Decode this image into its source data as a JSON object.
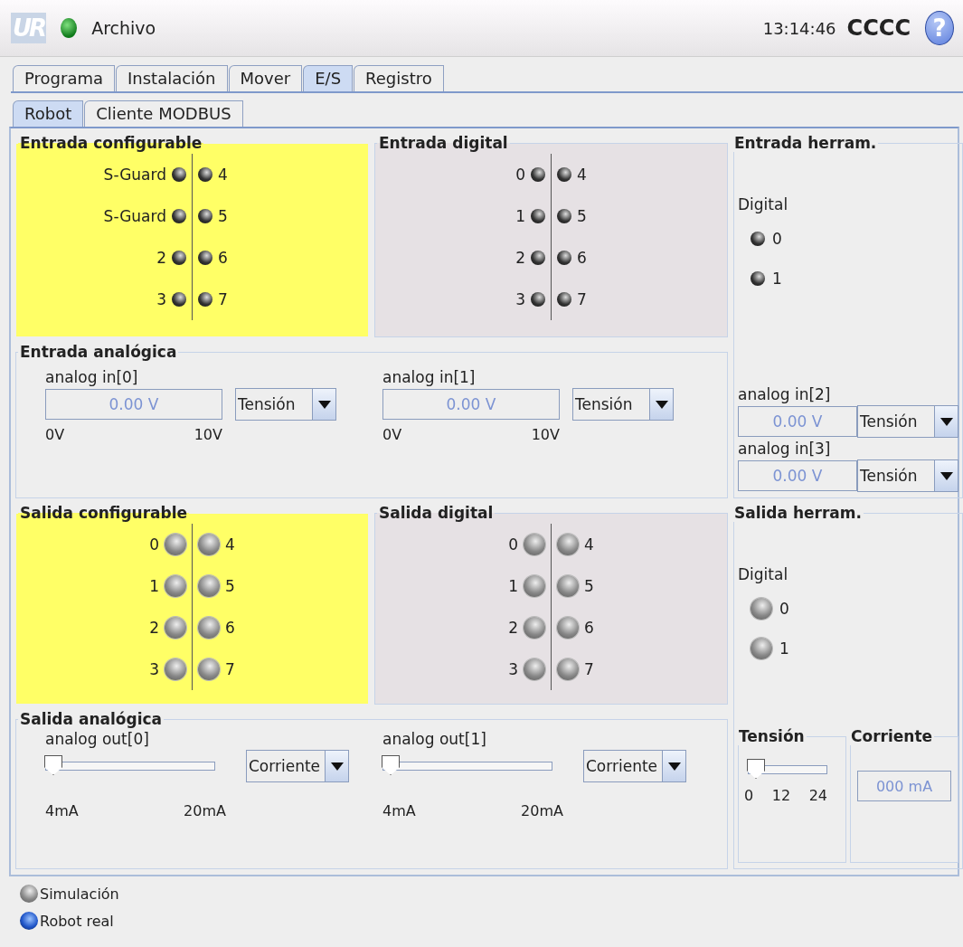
{
  "header": {
    "logo": "UR",
    "status_on": true,
    "menu": "Archivo",
    "time": "13:14:46",
    "robot_name": "CCCC",
    "help": "?"
  },
  "tabs": [
    {
      "label": "Programa",
      "selected": false
    },
    {
      "label": "Instalación",
      "selected": false
    },
    {
      "label": "Mover",
      "selected": false
    },
    {
      "label": "E/S",
      "selected": true
    },
    {
      "label": "Registro",
      "selected": false
    }
  ],
  "subtabs": [
    {
      "label": "Robot",
      "selected": true
    },
    {
      "label": "Cliente MODBUS",
      "selected": false
    }
  ],
  "entrada_configurable": {
    "title": "Entrada configurable",
    "kind": "input",
    "color": "#ffff66",
    "left": [
      {
        "label": "S-Guard",
        "on": false
      },
      {
        "label": "S-Guard",
        "on": false
      },
      {
        "label": "2",
        "on": false
      },
      {
        "label": "3",
        "on": false
      }
    ],
    "right": [
      {
        "label": "4",
        "on": false
      },
      {
        "label": "5",
        "on": false
      },
      {
        "label": "6",
        "on": false
      },
      {
        "label": "7",
        "on": false
      }
    ]
  },
  "entrada_digital": {
    "title": "Entrada digital",
    "kind": "input",
    "color": "#e6e1e4",
    "left": [
      {
        "label": "0",
        "on": false
      },
      {
        "label": "1",
        "on": false
      },
      {
        "label": "2",
        "on": false
      },
      {
        "label": "3",
        "on": false
      }
    ],
    "right": [
      {
        "label": "4",
        "on": false
      },
      {
        "label": "5",
        "on": false
      },
      {
        "label": "6",
        "on": false
      },
      {
        "label": "7",
        "on": false
      }
    ]
  },
  "entrada_herram": {
    "title": "Entrada herram.",
    "digital_label": "Digital",
    "leds": [
      {
        "label": "0",
        "on": false
      },
      {
        "label": "1",
        "on": false
      }
    ],
    "analog": [
      {
        "label": "analog in[2]",
        "value": "0.00 V",
        "mode": "Tensión"
      },
      {
        "label": "analog in[3]",
        "value": "0.00 V",
        "mode": "Tensión"
      }
    ]
  },
  "entrada_analogica": {
    "title": "Entrada analógica",
    "inputs": [
      {
        "label": "analog in[0]",
        "value": "0.00 V",
        "mode": "Tensión",
        "min": "0V",
        "max": "10V"
      },
      {
        "label": "analog in[1]",
        "value": "0.00 V",
        "mode": "Tensión",
        "min": "0V",
        "max": "10V"
      }
    ]
  },
  "salida_configurable": {
    "title": "Salida configurable",
    "kind": "output",
    "color": "#ffff66",
    "left": [
      {
        "label": "0",
        "on": false
      },
      {
        "label": "1",
        "on": false
      },
      {
        "label": "2",
        "on": false
      },
      {
        "label": "3",
        "on": false
      }
    ],
    "right": [
      {
        "label": "4",
        "on": false
      },
      {
        "label": "5",
        "on": false
      },
      {
        "label": "6",
        "on": false
      },
      {
        "label": "7",
        "on": false
      }
    ]
  },
  "salida_digital": {
    "title": "Salida digital",
    "kind": "output",
    "color": "#e6e1e4",
    "left": [
      {
        "label": "0",
        "on": false
      },
      {
        "label": "1",
        "on": false
      },
      {
        "label": "2",
        "on": false
      },
      {
        "label": "3",
        "on": false
      }
    ],
    "right": [
      {
        "label": "4",
        "on": false
      },
      {
        "label": "5",
        "on": false
      },
      {
        "label": "6",
        "on": false
      },
      {
        "label": "7",
        "on": false
      }
    ]
  },
  "salida_herram": {
    "title": "Salida herram.",
    "digital_label": "Digital",
    "leds": [
      {
        "label": "0",
        "on": false
      },
      {
        "label": "1",
        "on": false
      }
    ],
    "tension": {
      "title": "Tensión",
      "level": 0,
      "ticks": [
        "0",
        "12",
        "24"
      ]
    },
    "corriente": {
      "title": "Corriente",
      "value": "000 mA"
    }
  },
  "salida_analogica": {
    "title": "Salida analógica",
    "outputs": [
      {
        "label": "analog out[0]",
        "level": 0,
        "mode": "Corriente",
        "min": "4mA",
        "max": "20mA"
      },
      {
        "label": "analog out[1]",
        "level": 0,
        "mode": "Corriente",
        "min": "4mA",
        "max": "20mA"
      }
    ]
  },
  "footer": [
    {
      "label": "Simulación",
      "selected": false
    },
    {
      "label": "Robot real",
      "selected": true
    }
  ]
}
